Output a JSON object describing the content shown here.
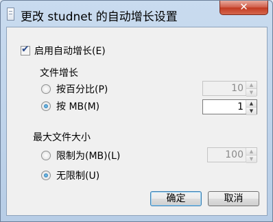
{
  "window": {
    "title": "更改 studnet 的自动增长设置",
    "close_glyph": "✕"
  },
  "autogrowth": {
    "label": "启用自动增长(E)",
    "checked": true
  },
  "file_growth": {
    "heading": "文件增长",
    "percent_label": "按百分比(P)",
    "percent_value": "10",
    "mb_label": "按 MB(M)",
    "mb_value": "1",
    "selected": "mb"
  },
  "max_size": {
    "heading": "最大文件大小",
    "limited_label": "限制为(MB)(L)",
    "limited_value": "100",
    "unlimited_label": "无限制(U)",
    "selected": "unlimited"
  },
  "buttons": {
    "ok": "确定",
    "cancel": "取消"
  }
}
